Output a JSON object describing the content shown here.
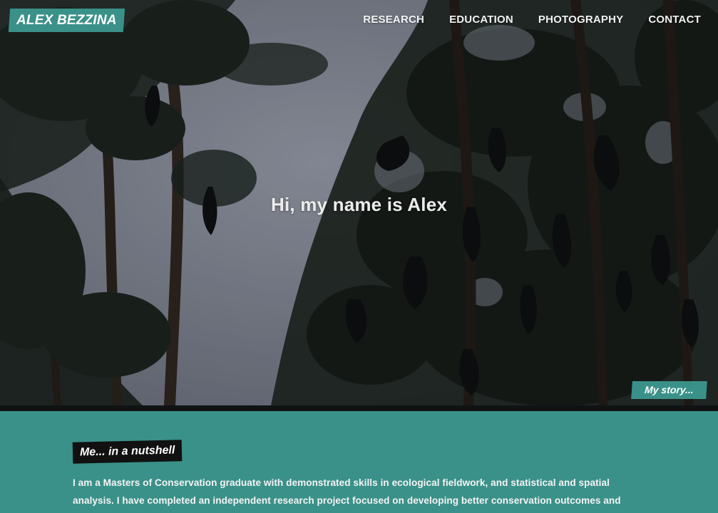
{
  "header": {
    "logo_text": "ALEX BEZZINA",
    "nav": [
      {
        "label": "RESEARCH"
      },
      {
        "label": "EDUCATION"
      },
      {
        "label": "PHOTOGRAPHY"
      },
      {
        "label": "CONTACT"
      }
    ]
  },
  "hero": {
    "title": "Hi, my name is Alex",
    "cta_label": "My story...",
    "background_image": "bats-hanging-in-trees-photo"
  },
  "about": {
    "heading": "Me... in a nutshell",
    "text": "I am a Masters of Conservation graduate with demonstrated skills in ecological fieldwork, and statistical and spatial analysis. I have completed an independent research project focused on developing better conservation outcomes and"
  },
  "colors": {
    "accent": "#3a9189",
    "dark": "#111111",
    "sky": "#7d8290"
  }
}
